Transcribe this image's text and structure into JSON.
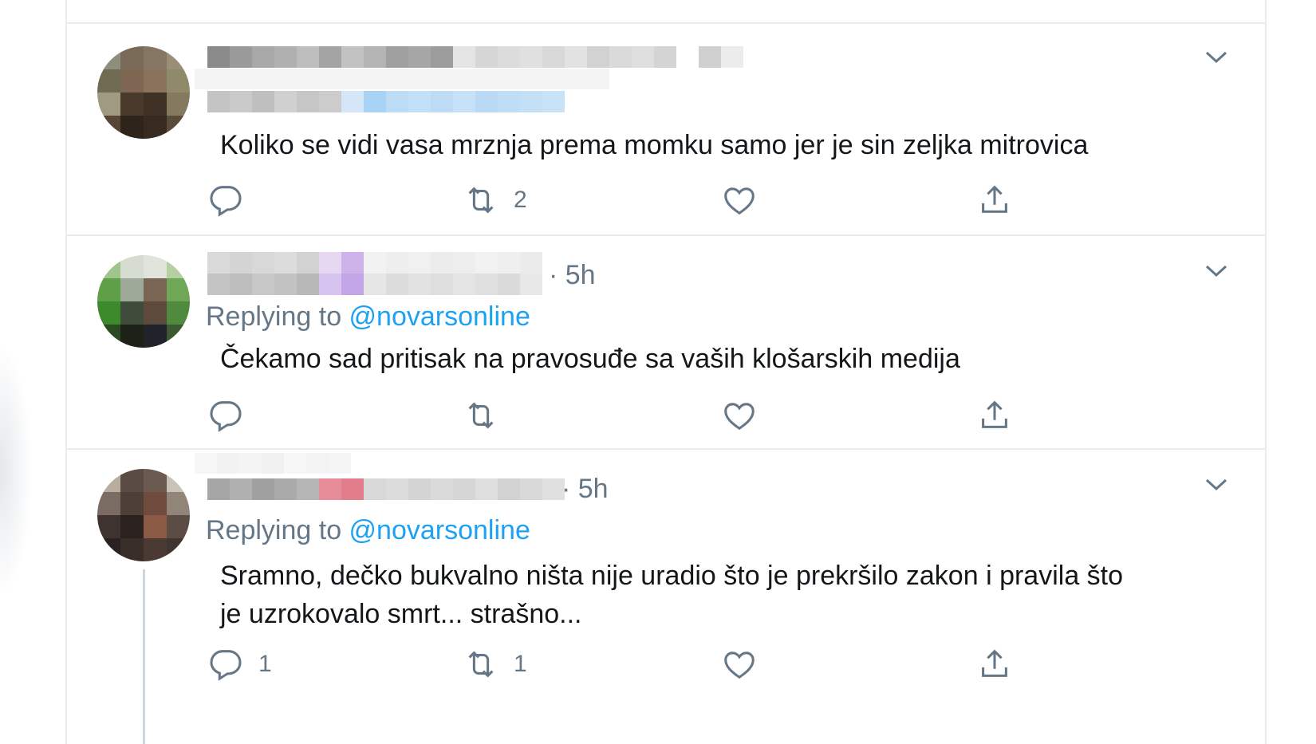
{
  "colors": {
    "accent": "#1da1f2",
    "secondary_text": "#657786",
    "primary_text": "#14171a",
    "border": "#e6ecf0"
  },
  "tweets": [
    {
      "time": "",
      "replying_prefix": "",
      "replying_handle": "",
      "text": "Koliko se vidi vasa mrznja prema momku samo jer je sin zeljka mitrovica",
      "reply_count": "",
      "retweet_count": "2",
      "like_count": "",
      "icons": [
        "reply-icon",
        "retweet-icon",
        "like-icon",
        "share-icon",
        "chevron-down-icon"
      ]
    },
    {
      "time": "· 5h",
      "replying_prefix": "Replying to ",
      "replying_handle": "@novarsonline",
      "text": "Čekamo sad pritisak na pravosuđe sa vaših klošarskih medija",
      "reply_count": "",
      "retweet_count": "",
      "like_count": "",
      "icons": [
        "reply-icon",
        "retweet-icon",
        "like-icon",
        "share-icon",
        "chevron-down-icon"
      ]
    },
    {
      "time": "· 5h",
      "replying_prefix": "Replying to ",
      "replying_handle": "@novarsonline",
      "text_line1": "Sramno, dečko bukvalno ništa nije uradio što je prekršilo zakon i pravila što",
      "text_line2": "je uzrokovalo smrt... strašno...",
      "reply_count": "1",
      "retweet_count": "1",
      "like_count": "",
      "icons": [
        "reply-icon",
        "retweet-icon",
        "like-icon",
        "share-icon",
        "chevron-down-icon"
      ]
    }
  ]
}
